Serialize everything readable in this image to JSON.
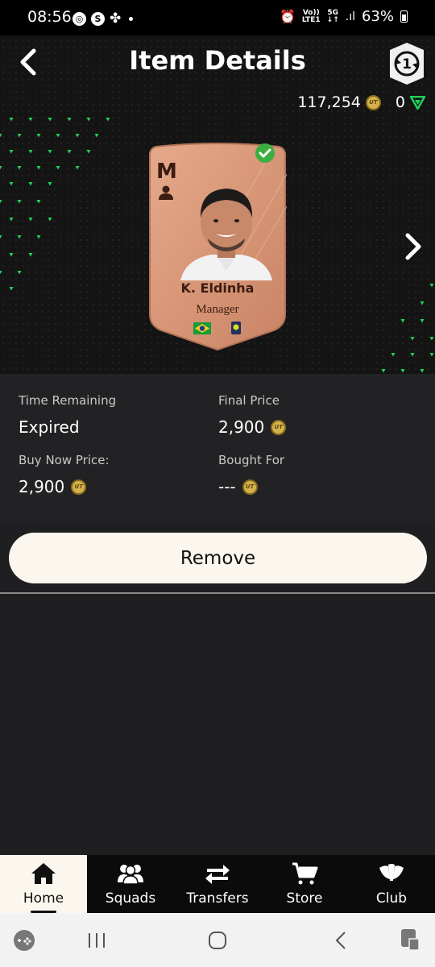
{
  "status_bar": {
    "time": "08:56",
    "network_top": "Vo))",
    "network_bottom": "LTE1",
    "gen_top": "5G",
    "battery": "63%"
  },
  "header": {
    "title": "Item Details",
    "coins": "117,254",
    "points": "0"
  },
  "card": {
    "rating": "M",
    "name": "K. Eldinha",
    "position": "Manager",
    "nation": "Brazil",
    "colors": {
      "card": "#d99a7b",
      "text": "#3a1c12",
      "check": "#3cae3f"
    }
  },
  "details": {
    "time_remaining_label": "Time Remaining",
    "time_remaining_value": "Expired",
    "final_price_label": "Final Price",
    "final_price_value": "2,900",
    "buy_now_label": "Buy Now Price:",
    "buy_now_value": "2,900",
    "bought_for_label": "Bought For",
    "bought_for_value": "---"
  },
  "actions": {
    "remove_label": "Remove"
  },
  "nav": {
    "items": [
      {
        "label": "Home",
        "icon": "home-icon",
        "active": true
      },
      {
        "label": "Squads",
        "icon": "squads-icon",
        "active": false
      },
      {
        "label": "Transfers",
        "icon": "transfers-icon",
        "active": false
      },
      {
        "label": "Store",
        "icon": "store-icon",
        "active": false
      },
      {
        "label": "Club",
        "icon": "club-icon",
        "active": false
      }
    ]
  },
  "colors": {
    "accent": "#fbf7ee",
    "background": "#1f1f21",
    "header_bg": "#141414",
    "dot_green": "#1fd35a"
  }
}
